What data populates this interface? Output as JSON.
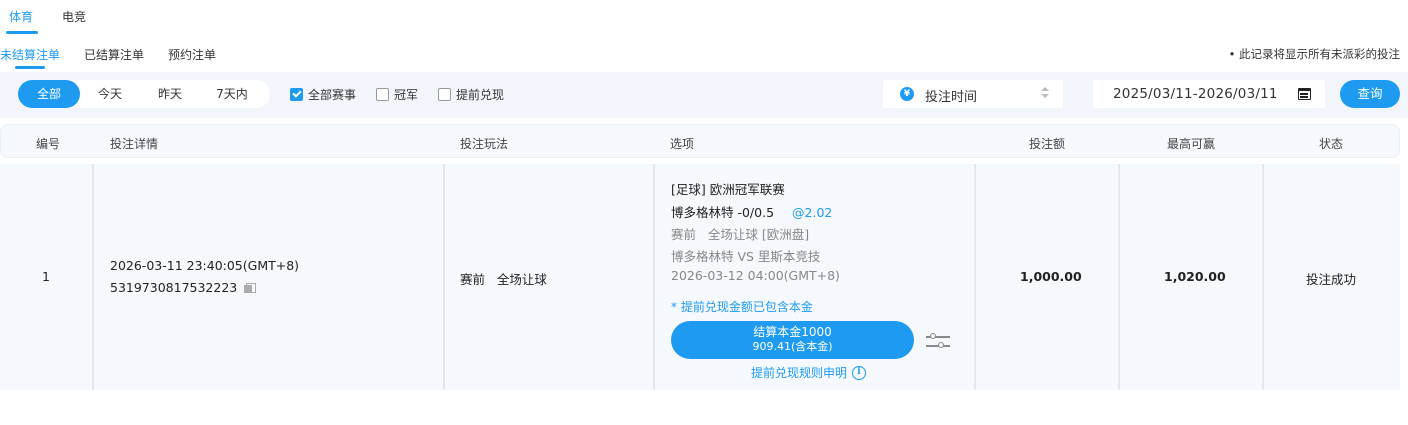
{
  "top_tabs": [
    {
      "label": "体育",
      "active": true
    },
    {
      "label": "电竞",
      "active": false
    }
  ],
  "sub_tabs": [
    {
      "label": "未结算注单",
      "active": true
    },
    {
      "label": "已结算注单",
      "active": false
    },
    {
      "label": "预约注单",
      "active": false
    }
  ],
  "note": "• 此记录将显示所有未派彩的投注",
  "filters": {
    "ranges": [
      {
        "label": "全部",
        "active": true
      },
      {
        "label": "今天",
        "active": false
      },
      {
        "label": "昨天",
        "active": false
      },
      {
        "label": "7天内",
        "active": false
      }
    ],
    "checkboxes": [
      {
        "label": "全部赛事",
        "checked": true
      },
      {
        "label": "冠军",
        "checked": false
      },
      {
        "label": "提前兑现",
        "checked": false
      }
    ],
    "sort_icon": "¥",
    "sort_label": "投注时间",
    "date_range": "2025/03/11-2026/03/11",
    "query_label": "查询"
  },
  "table": {
    "headers": [
      "编号",
      "投注详情",
      "投注玩法",
      "选项",
      "投注额",
      "最高可赢",
      "状态"
    ],
    "rows": [
      {
        "index": "1",
        "bet_time": "2026-03-11 23:40:05(GMT+8)",
        "bet_id": "5319730817532223",
        "play_type": "赛前   全场让球",
        "option": {
          "league": "[足球] 欧洲冠军联赛",
          "selection": "博多格林特 -0/0.5",
          "odds": "@2.02",
          "market": "赛前   全场让球 [欧洲盘]",
          "match": "博多格林特 VS 里斯本竞技",
          "match_time": "2026-03-12 04:00(GMT+8)",
          "cashout_note": "* 提前兑现金额已包含本金",
          "cashout_line1": "结算本金1000",
          "cashout_line2": "909.41(含本金)",
          "rules_link": "提前兑现规则申明",
          "info_glyph": "i"
        },
        "stake": "1,000.00",
        "max_win": "1,020.00",
        "status": "投注成功"
      }
    ]
  },
  "colors": {
    "accent": "#1e9bf0",
    "row_bg": "#f5f8fd",
    "filter_bg": "#f2f6fc"
  }
}
